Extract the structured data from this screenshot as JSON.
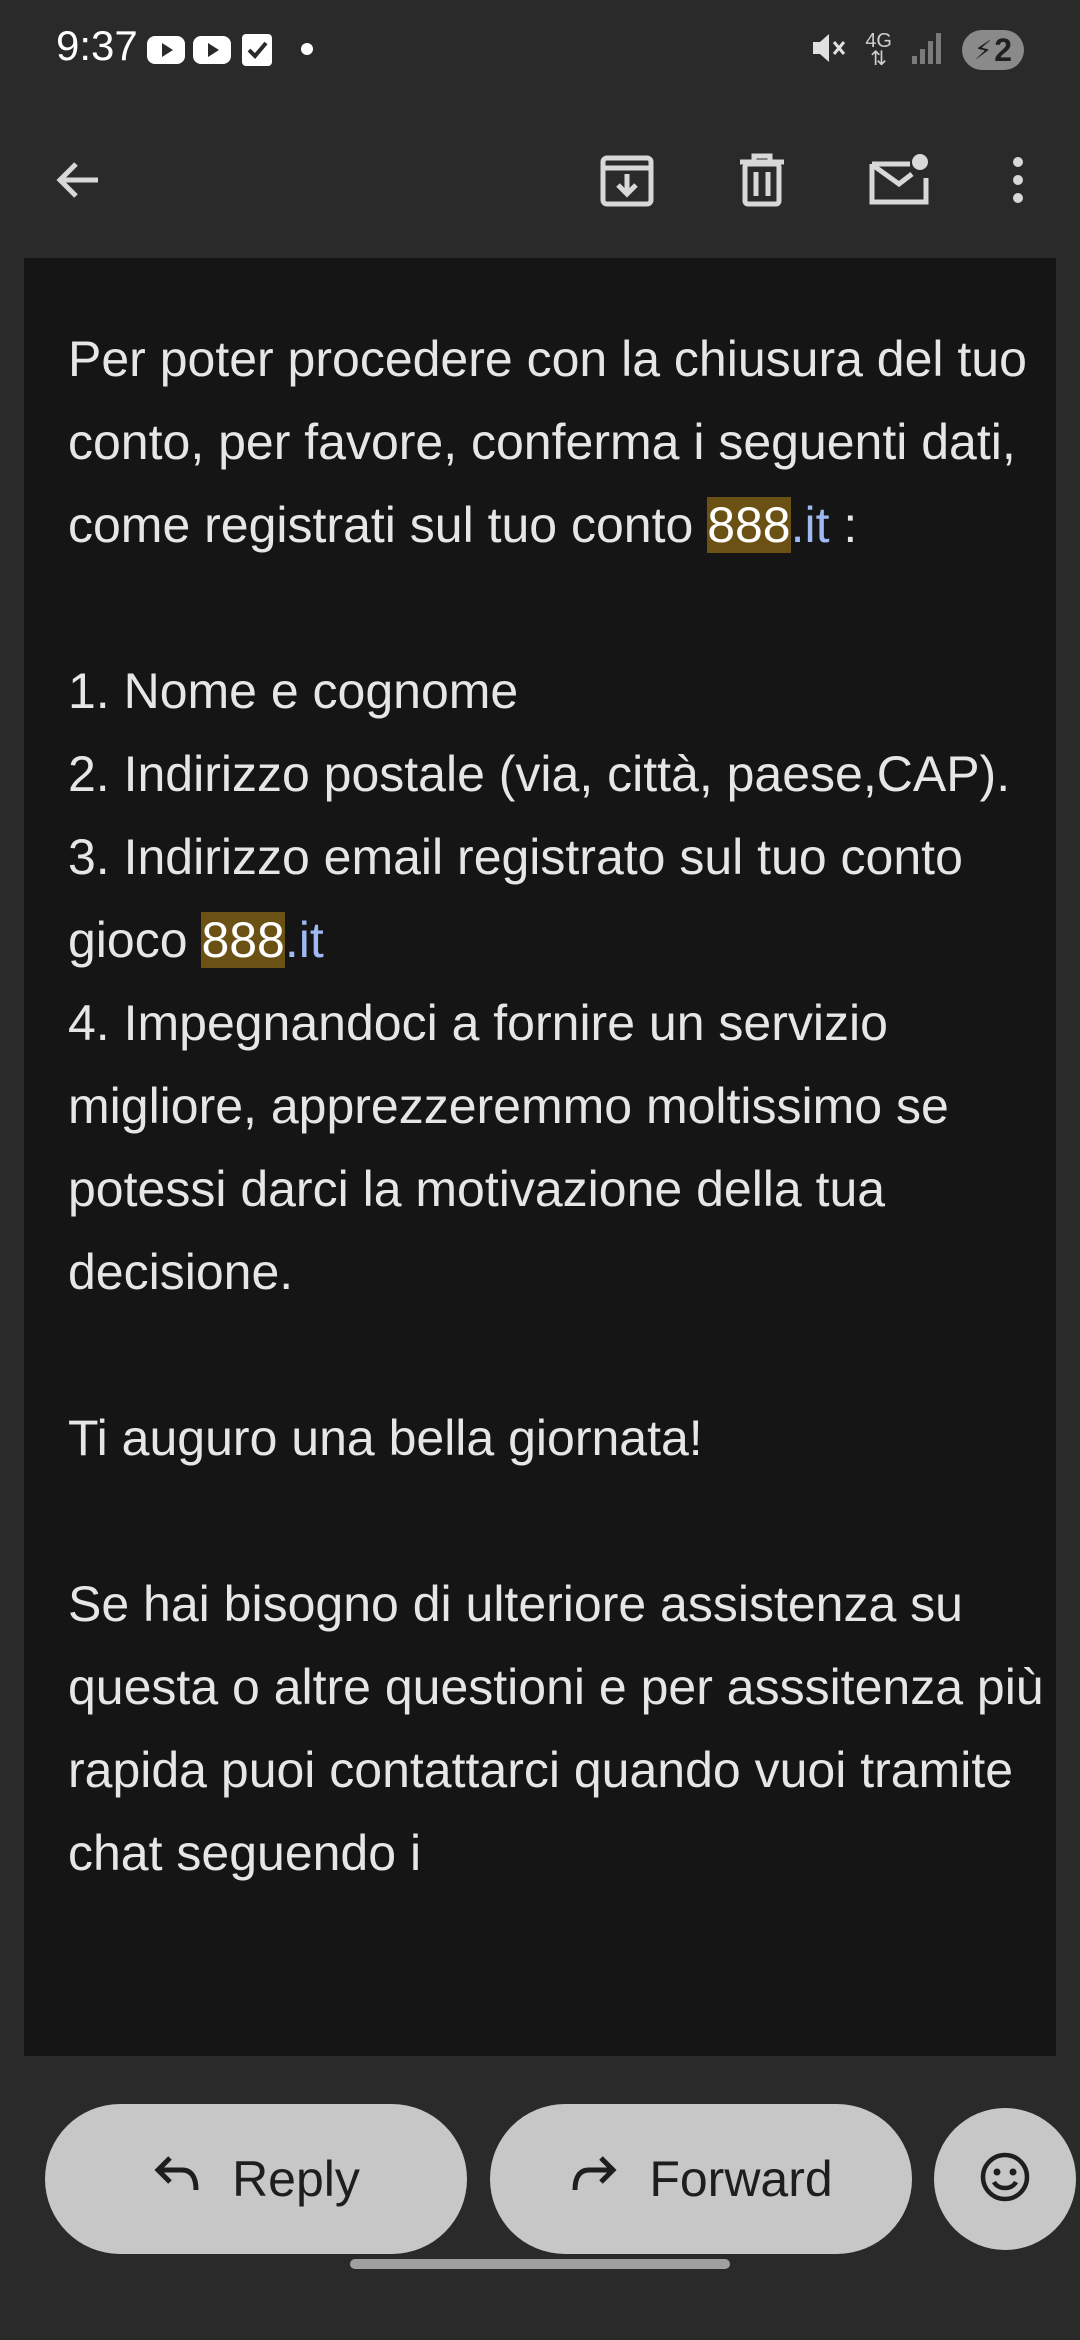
{
  "status_bar": {
    "time": "9:37",
    "network_type": "4G",
    "battery_level": "2",
    "icons": [
      "youtube-icon",
      "youtube-icon",
      "checkbox-icon",
      "dot-icon",
      "mute-icon",
      "data-arrows-icon",
      "signal-icon",
      "battery-charging-icon"
    ]
  },
  "toolbar": {
    "icons": [
      "back-arrow-icon",
      "archive-icon",
      "delete-icon",
      "mark-unread-icon",
      "more-vert-icon"
    ]
  },
  "email": {
    "intro_1": "Per poter procedere con la chiusura del tuo conto, per favore, conferma i seguenti dati, come registrati sul tuo conto ",
    "intro_hl": "888",
    "intro_link": ".it",
    "intro_end": " :",
    "item_1": "1. Nome e cognome",
    "item_2": "2. Indirizzo postale (via, città, paese,CAP).",
    "item_3_text": "3. Indirizzo email registrato sul tuo conto gioco ",
    "item_3_hl": "888",
    "item_3_link": ".it",
    "item_4": "4. Impegnandoci a fornire un servizio migliore, apprezzeremmo moltissimo se potessi darci la motivazione della tua decisione.",
    "greeting": "Ti auguro una bella giornata!",
    "closing": "Se hai bisogno di ulteriore assistenza su questa o altre questioni e per asssitenza più rapida  puoi contattarci quando vuoi tramite chat seguendo i"
  },
  "actions": {
    "reply_label": "Reply",
    "forward_label": "Forward",
    "reply_icon": "reply-icon",
    "forward_icon": "forward-icon",
    "emoji_icon": "emoji-icon"
  },
  "colors": {
    "background": "#2a2a2a",
    "card": "#151515",
    "highlight": "#6b5114",
    "link": "#9fb9f2",
    "pill": "#c7c7c7"
  }
}
